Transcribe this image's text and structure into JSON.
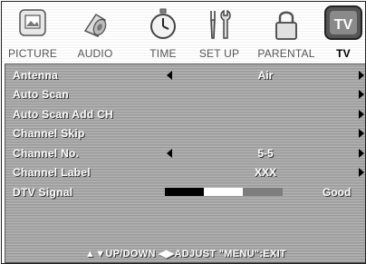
{
  "tabs": [
    {
      "label": "PICTURE",
      "icon": "picture-icon",
      "active": false
    },
    {
      "label": "AUDIO",
      "icon": "speaker-icon",
      "active": false
    },
    {
      "label": "TIME",
      "icon": "stopwatch-icon",
      "active": false
    },
    {
      "label": "SET UP",
      "icon": "tools-icon",
      "active": false
    },
    {
      "label": "PARENTAL",
      "icon": "lock-icon",
      "active": false
    },
    {
      "label": "TV",
      "icon": "tv-icon",
      "active": true
    }
  ],
  "menu": {
    "antenna": {
      "label": "Antenna",
      "value": "Air"
    },
    "auto_scan": {
      "label": "Auto Scan"
    },
    "auto_scan_add": {
      "label": "Auto Scan Add CH"
    },
    "channel_skip": {
      "label": "Channel Skip"
    },
    "channel_no": {
      "label": "Channel No.",
      "value": "5-5"
    },
    "channel_label": {
      "label": "Channel Label",
      "value": "XXX"
    },
    "dtv_signal": {
      "label": "DTV Signal",
      "status": "Good",
      "level": 0.66
    }
  },
  "footer": {
    "hint": "▲▼UP/DOWN ◀▶ADJUST \"MENU\":EXIT"
  }
}
